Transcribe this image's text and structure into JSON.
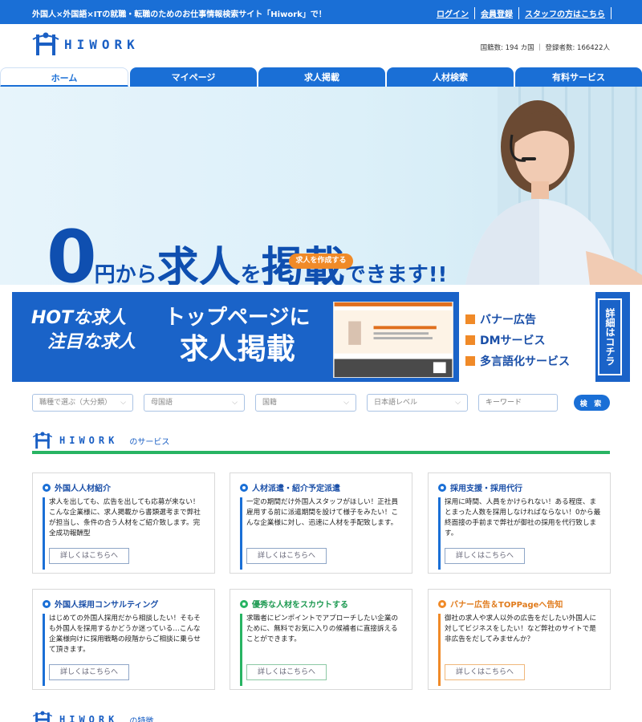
{
  "topbar": {
    "tagline": "外国人×外国語×ITの就職・転職のためのお仕事情報検索サイト「Hiwork」で！",
    "links": [
      "ログイン",
      "会員登録",
      "スタッフの方はこちら"
    ]
  },
  "header": {
    "logo": "HIWORK",
    "stats": "国籍数: 194 カ国 ｜ 登録者数: 166422人"
  },
  "nav": {
    "tabs": [
      "ホーム",
      "マイページ",
      "求人掲載",
      "人材検索",
      "有料サービス"
    ],
    "active": 0
  },
  "hero": {
    "h_zero": "0",
    "h_en": "円から",
    "h_kyujin": "求人",
    "h_wo": "を",
    "h_keisai": "掲載",
    "h_end": "できます!!",
    "cta": "求人を作成する"
  },
  "banner": {
    "hot_line1": "HOTな求人",
    "hot_line2": "注目な求人",
    "top_line1": "トップページに",
    "top_line2": "求人掲載",
    "services": [
      "バナー広告",
      "DMサービス",
      "多言語化サービス"
    ],
    "more": "詳細はコチラ"
  },
  "search": {
    "selects": [
      "職種で選ぶ（大分類）",
      "母国語",
      "国籍",
      "日本語レベル"
    ],
    "keyword_placeholder": "キーワード",
    "button": "検 索"
  },
  "services_section": {
    "logo": "HIWORK",
    "subtitle": "のサービス",
    "cards": [
      {
        "title": "外国人人材紹介",
        "desc": "求人を出しても、広告を出しても応募が来ない！こんな企業様に、求人掲載から書類選考まで弊社が担当し、条件の合う人材をご紹介致します。完全成功報酬型",
        "button": "詳しくはこちらへ"
      },
      {
        "title": "人材派遣・紹介予定派遣",
        "desc": "一定の期間だけ外国人スタッフがほしい！正社員雇用する前に派遣期間を設けて様子をみたい！こんな企業様に対し、迅速に人材を手配致します。",
        "button": "詳しくはこちらへ"
      },
      {
        "title": "採用支援・採用代行",
        "desc": "採用に時間、人員をかけられない！ある程度、まとまった人数を採用しなければならない！0から最終面接の手前まで弊社が御社の採用を代行致します。",
        "button": "詳しくはこちらへ"
      },
      {
        "title": "外国人採用コンサルティング",
        "desc": "はじめての外国人採用だから相談したい！そもそも外国人を採用するかどうか迷っている…こんな企業様向けに採用戦略の段階からご相談に乗らせて頂きます。",
        "button": "詳しくはこちらへ"
      },
      {
        "title": "優秀な人材をスカウトする",
        "desc": "求職者にピンポイントでアプローチしたい企業のために、無料でお気に入りの候補者に直接訴えることができます。",
        "button": "詳しくはこちらへ"
      },
      {
        "title": "バナー広告＆TOPPageへ告知",
        "desc": "御社の求人や求人以外の広告をだしたい外国人に対してビジネスをしたい！など弊社のサイトで是非広告をだしてみませんか？",
        "button": "詳しくはこちらへ"
      }
    ]
  },
  "features_section": {
    "logo": "HIWORK",
    "subtitle": "の特徴"
  },
  "colors": {
    "brand_blue": "#1a6fd6",
    "accent_orange": "#f08a28",
    "accent_green": "#28b463"
  }
}
